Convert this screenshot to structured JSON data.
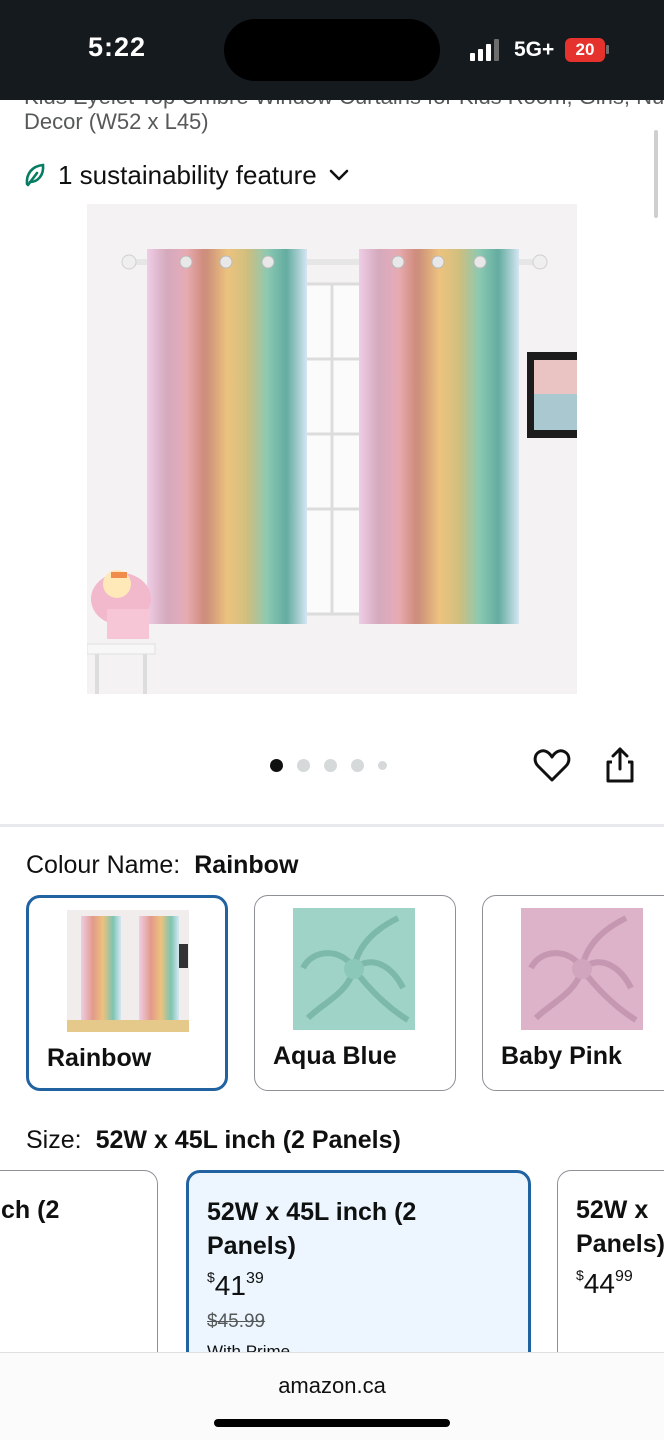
{
  "status_bar": {
    "time": "5:22",
    "network": "5G+",
    "battery": "20"
  },
  "product": {
    "title_cut": "Kids Eyelet Top Ombre Window Curtains for Kids Room, Girls, Nursery",
    "title_line": "Decor (W52 x L45)",
    "sustainability": "1 sustainability feature",
    "image_count": 5,
    "active_image": 1
  },
  "colour": {
    "label": "Colour Name:",
    "selected": "Rainbow",
    "options": [
      {
        "name": "Rainbow",
        "color": "#c9b98a"
      },
      {
        "name": "Aqua Blue",
        "color": "#9fd3c7"
      },
      {
        "name": "Baby Pink",
        "color": "#dcb3c9"
      }
    ]
  },
  "size": {
    "label": "Size:",
    "selected": "52W x 45L inch (2 Panels)",
    "options": [
      {
        "line1": "ch (2",
        "line2": ""
      },
      {
        "line1": "52W x 45L inch (2",
        "line2": "Panels)",
        "currency": "$",
        "dollars": "41",
        "cents": "39",
        "list_price": "$45.99",
        "note": "With Prime"
      },
      {
        "line1": "52W x",
        "line2": "Panels)",
        "currency": "$",
        "dollars": "44",
        "cents": "99"
      }
    ]
  },
  "browser": {
    "url": "amazon.ca"
  },
  "colors": {
    "selected_border": "#2162a1",
    "selected_bg": "#edf6ff",
    "leaf_green": "#067d62"
  }
}
